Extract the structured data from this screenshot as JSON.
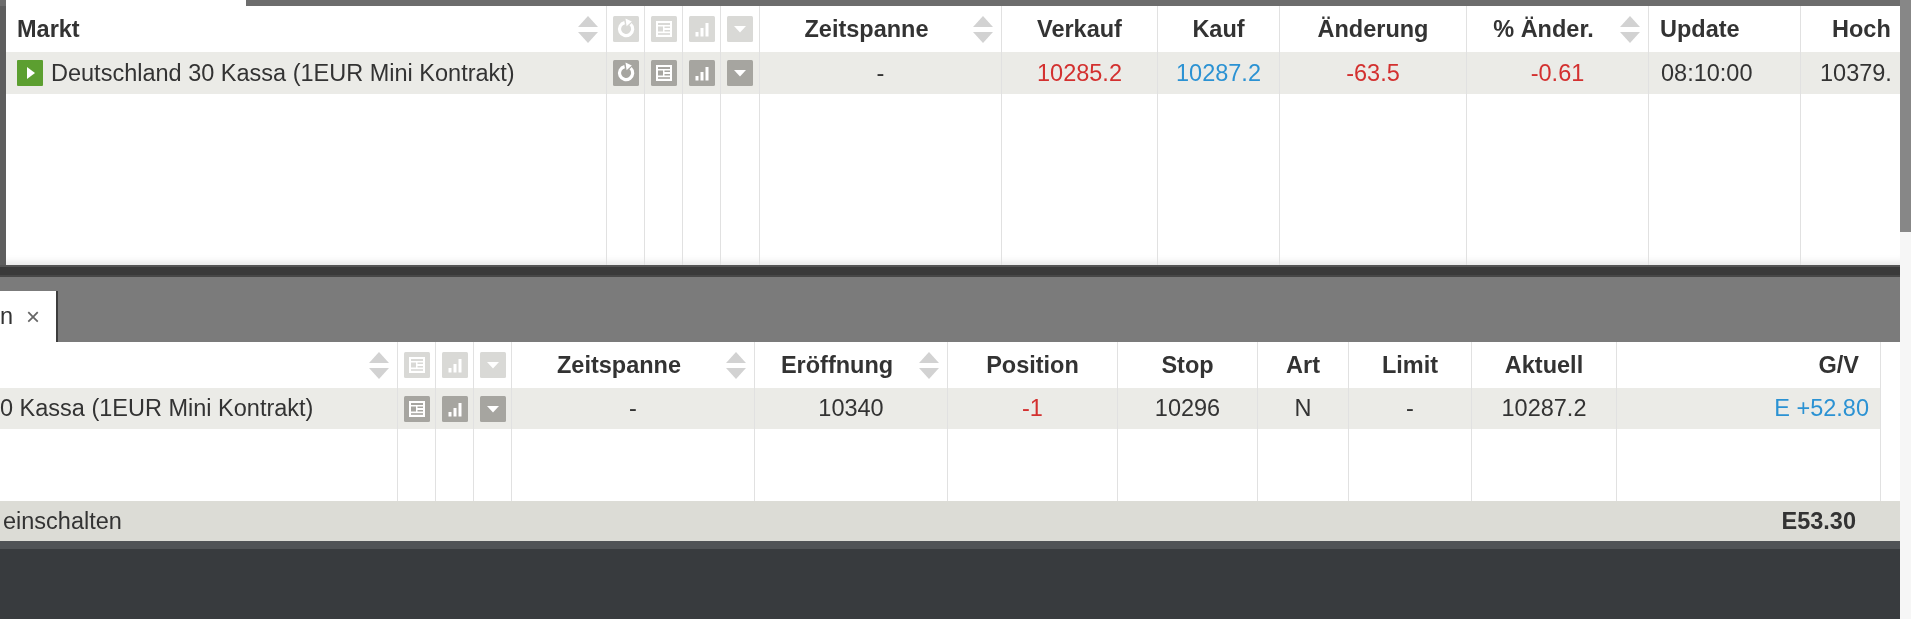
{
  "watchlist": {
    "columns": [
      {
        "label": "Markt",
        "sortable": true
      },
      {
        "label": "Zeitspanne",
        "sortable": true
      },
      {
        "label": "Verkauf",
        "sortable": false
      },
      {
        "label": "Kauf",
        "sortable": false
      },
      {
        "label": "Änderung",
        "sortable": false
      },
      {
        "label": "% Änder.",
        "sortable": true
      },
      {
        "label": "Update",
        "sortable": false
      },
      {
        "label": "Hoch",
        "sortable": false
      }
    ],
    "rows": [
      {
        "cells": [
          {
            "text": "Deutschland 30 Kassa (1EUR Mini Kontrakt)"
          },
          {
            "text": "-"
          },
          {
            "text": "10285.2",
            "color": "#d3302f"
          },
          {
            "text": "10287.2",
            "color": "#2b92d3"
          },
          {
            "text": "-63.5",
            "color": "#d3302f"
          },
          {
            "text": "-0.61",
            "color": "#d3302f"
          },
          {
            "text": "08:10:00"
          },
          {
            "text": "10379."
          }
        ]
      }
    ]
  },
  "positions": {
    "tab": {
      "label": "n",
      "close": "×"
    },
    "columns": [
      {
        "sortable": true
      },
      {
        "label": "Zeitspanne",
        "sortable": true
      },
      {
        "label": "Eröffnung",
        "sortable": true
      },
      {
        "label": "Position",
        "sortable": false
      },
      {
        "label": "Stop",
        "sortable": false
      },
      {
        "label": "Art",
        "sortable": false
      },
      {
        "label": "Limit",
        "sortable": false
      },
      {
        "label": "Aktuell",
        "sortable": false
      },
      {
        "label": "G/V",
        "sortable": false
      }
    ],
    "rows": [
      {
        "cells": [
          {
            "text": "0 Kassa (1EUR Mini Kontrakt)"
          },
          {
            "text": "-"
          },
          {
            "text": "10340"
          },
          {
            "text": "-1",
            "color": "#d3302f"
          },
          {
            "text": "10296"
          },
          {
            "text": "N"
          },
          {
            "text": "-"
          },
          {
            "text": "10287.2"
          },
          {
            "text": "E +52.80",
            "color": "#2b92d3"
          }
        ]
      }
    ],
    "footer": {
      "status": "einschalten",
      "total": "E53.30"
    }
  }
}
